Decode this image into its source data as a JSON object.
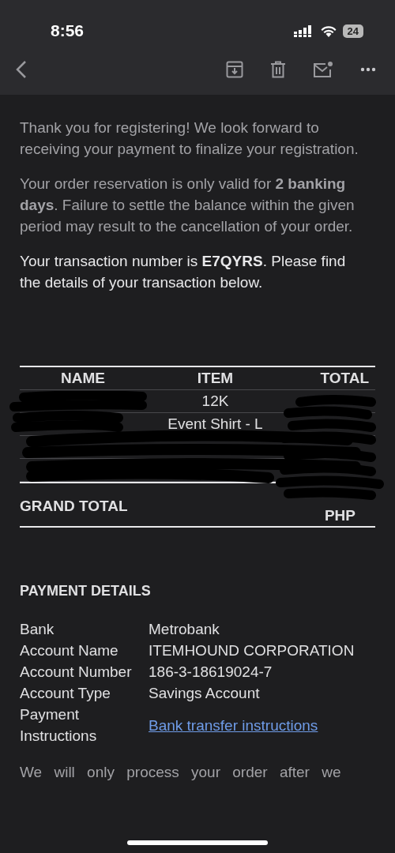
{
  "status_bar": {
    "time": "8:56",
    "battery": "24"
  },
  "paragraphs": [
    "Thank you for registering! We look forward to receiving your payment to finalize your registration.",
    "Your order reservation is only valid for **2 banking days**. Failure to settle the balance within the given period may result to the cancellation of your order.",
    "Your transaction number is **E7QYRS**. Please find the details of your transaction below."
  ],
  "table": {
    "columns": [
      "NAME",
      "ITEM",
      "TOTAL"
    ],
    "rows": [
      {
        "kind": "item",
        "item": "12K"
      },
      {
        "kind": "item",
        "item": "Event Shirt - L"
      },
      {
        "kind": "redacted"
      },
      {
        "kind": "redacted"
      }
    ],
    "grand_total_label": "GRAND TOTAL",
    "currency": "PHP"
  },
  "payment": {
    "heading": "PAYMENT DETAILS",
    "rows": [
      {
        "label": "Bank",
        "value": "Metrobank",
        "kind": "text"
      },
      {
        "label": "Account Name",
        "value": "ITEMHOUND CORPORATION",
        "kind": "text"
      },
      {
        "label": "Account Number",
        "value": "186-3-18619024-7",
        "kind": "text"
      },
      {
        "label": "Account Type",
        "value": "Savings Account",
        "kind": "text"
      },
      {
        "label": "Payment Instructions",
        "value": "Bank transfer instructions",
        "kind": "link"
      }
    ]
  },
  "footer_text": "We will only process your order after we"
}
